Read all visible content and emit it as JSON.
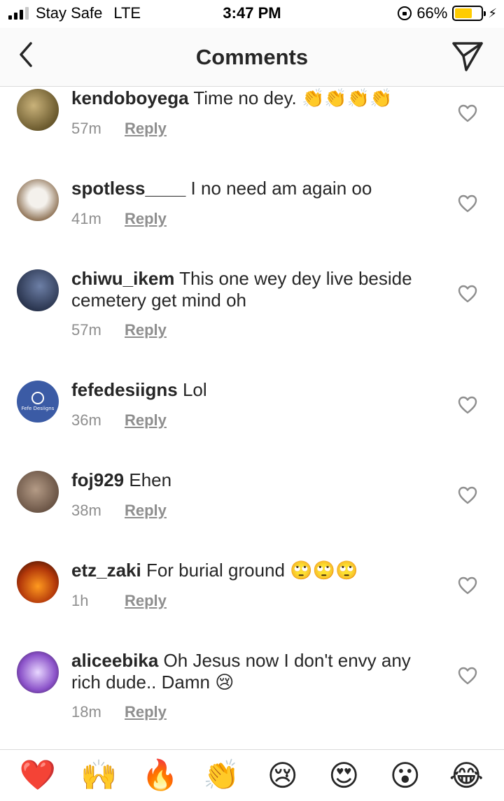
{
  "status_bar": {
    "carrier": "Stay Safe",
    "network": "LTE",
    "time": "3:47 PM",
    "battery_percent": "66%",
    "battery_level": 0.66,
    "battery_color": "#ffcc00"
  },
  "header": {
    "title": "Comments",
    "back_icon": "chevron-left-icon",
    "share_icon": "paper-plane-icon"
  },
  "reply_label": "Reply",
  "comments": [
    {
      "user": "kendoboyega",
      "text": "Time no dey.",
      "emoji": "👏👏👏👏",
      "time": "57m"
    },
    {
      "user": "spotless____",
      "text": "I no need am again oo",
      "emoji": "",
      "time": "41m"
    },
    {
      "user": "chiwu_ikem",
      "text": "This one wey dey live beside cemetery get mind oh",
      "emoji": "",
      "time": "57m"
    },
    {
      "user": "fefedesiigns",
      "text": "Lol",
      "emoji": "",
      "time": "36m",
      "avatar_text": "Fefe Desiigns"
    },
    {
      "user": "foj929",
      "text": "Ehen",
      "emoji": "",
      "time": "38m"
    },
    {
      "user": "etz_zaki",
      "text": "For burial ground",
      "emoji": "🙄🙄🙄",
      "time": "1h"
    },
    {
      "user": "aliceebika",
      "text": "Oh Jesus now I don't envy any rich dude.. Damn",
      "emoji": "😢",
      "time": "18m"
    }
  ],
  "emoji_bar": [
    "❤️",
    "🙌",
    "🔥",
    "👏",
    "😢",
    "😍",
    "😮",
    "😂"
  ]
}
